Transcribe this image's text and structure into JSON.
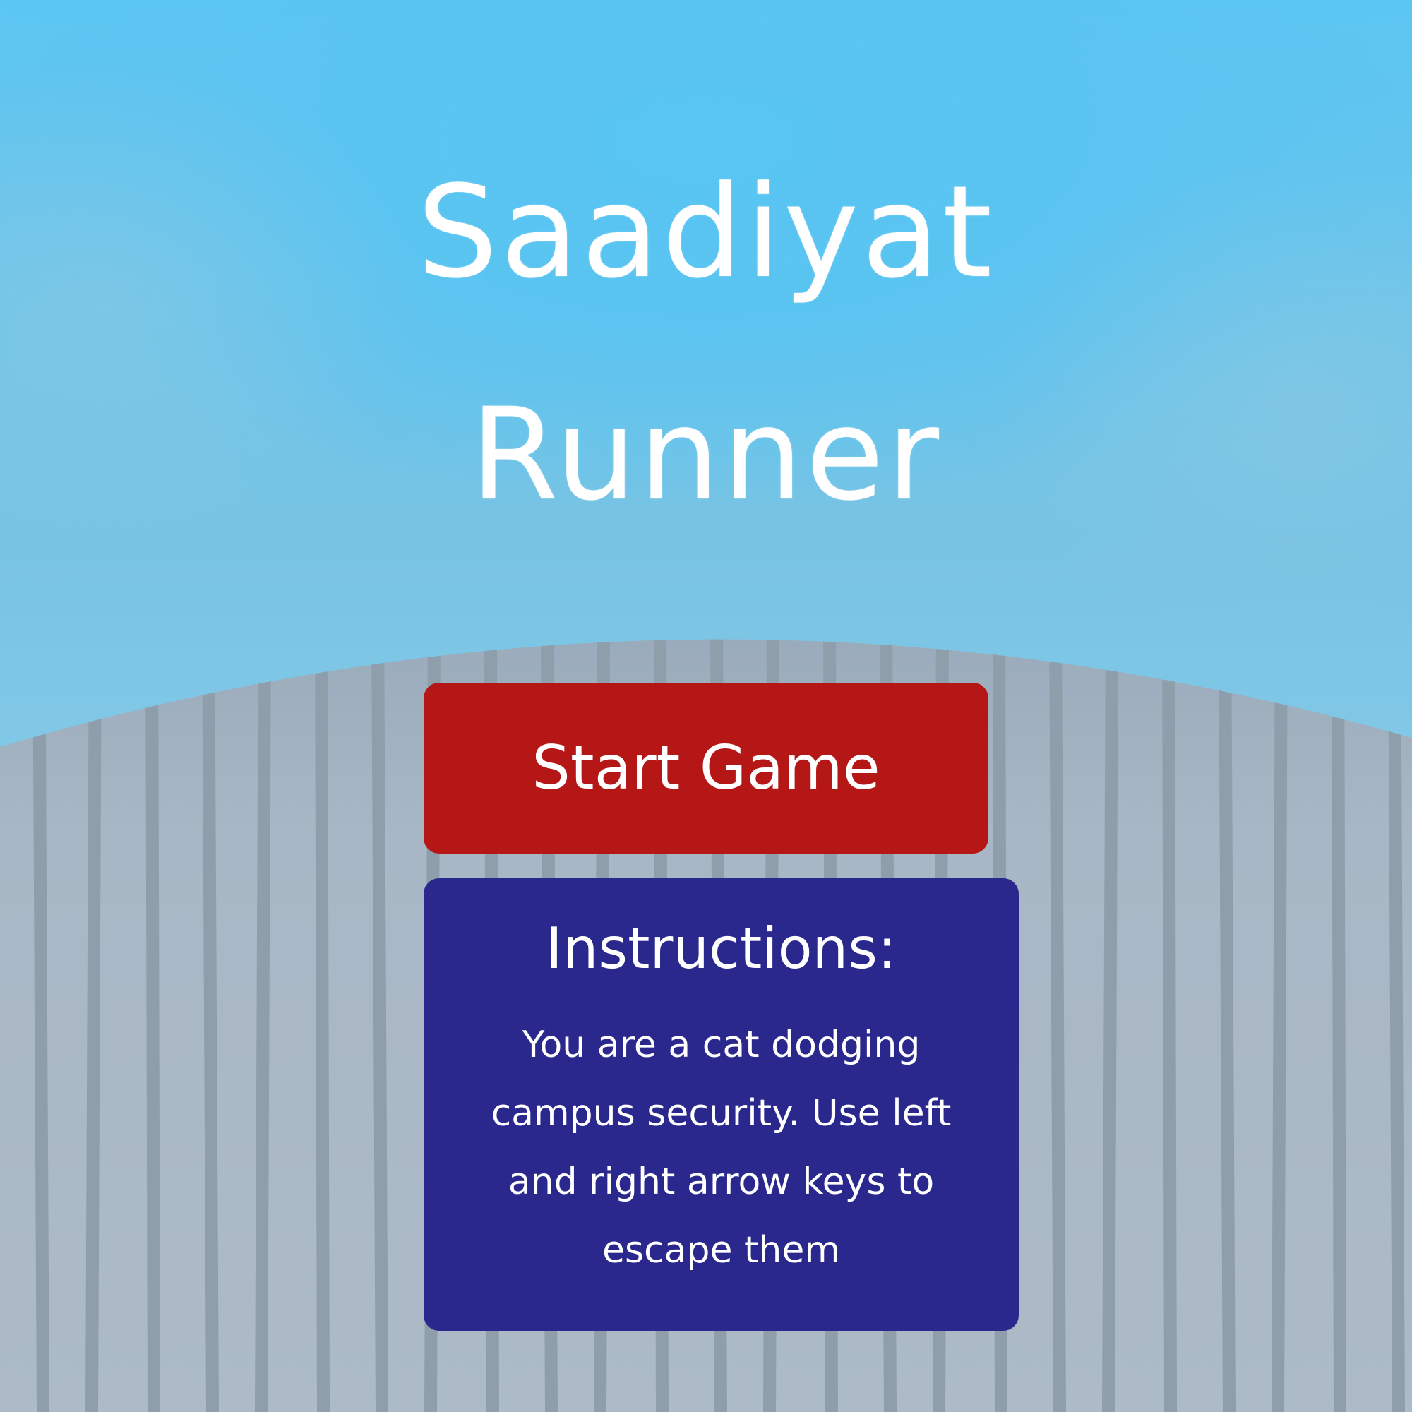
{
  "game": {
    "title_line_1": "Saadiyat",
    "title_line_2": "Runner"
  },
  "menu": {
    "start_label": "Start Game"
  },
  "instructions": {
    "heading": "Instructions:",
    "body": "You are a cat dodging campus security. Use left and right arrow keys to escape them"
  },
  "colors": {
    "sky": "#5cc6f1",
    "ground": "#a9b8c6",
    "stripe": "#8e9eaa",
    "start_button": "#b51616",
    "instructions_panel": "#2b288d",
    "text": "#ffffff"
  }
}
